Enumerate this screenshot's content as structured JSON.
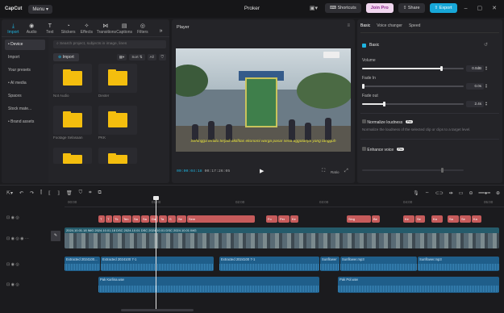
{
  "titlebar": {
    "logo": "CapCut",
    "menu": "Menu",
    "project_title": "Proker",
    "shortcuts": "Shortcuts",
    "join_pro": "Join Pro",
    "share": "Share",
    "export": "Export"
  },
  "left_tabs": [
    {
      "label": "Import",
      "icon": "import-icon"
    },
    {
      "label": "Audio",
      "icon": "audio-icon"
    },
    {
      "label": "Text",
      "icon": "text-icon"
    },
    {
      "label": "Stickers",
      "icon": "stickers-icon"
    },
    {
      "label": "Effects",
      "icon": "effects-icon"
    },
    {
      "label": "Transitions",
      "icon": "transitions-icon"
    },
    {
      "label": "Captions",
      "icon": "captions-icon"
    },
    {
      "label": "Filters",
      "icon": "filters-icon"
    }
  ],
  "sidenav": [
    "• Device",
    "Import",
    "Your presets",
    "• AI media",
    "Spaces",
    "Stock mate...",
    "• Brand assets"
  ],
  "media": {
    "search_placeholder": "Search project, subjects in image, lines",
    "import": "Import",
    "sort": "Sort",
    "filter_all": "All",
    "all_label": "All",
    "items": [
      "Not Audio",
      "Dexter",
      "Footage Selasaan",
      "PKK",
      "",
      ""
    ]
  },
  "player": {
    "title": "Player",
    "subtitle": "Sehingga terlalu terjadi aktifitas ekonomi warga pasar serta aggotanya yang tangguh",
    "current_time": "00:00:04:18",
    "total_time": "00:17:26:05",
    "ratio": "Ratio"
  },
  "props": {
    "tabs": [
      "Basic",
      "Voice changer",
      "Speed"
    ],
    "basic": "Basic",
    "volume": {
      "label": "Volume",
      "value": "0.0dB",
      "level": 0.78
    },
    "fade_in": {
      "label": "Fade In",
      "value": "0.0s",
      "level": 0.0
    },
    "fade_out": {
      "label": "Fade out",
      "value": "2.4s",
      "level": 0.22
    },
    "normalize": {
      "label": "Normalize loudness",
      "desc": "Normalize the loudness of the selected clip or clips to a target level."
    },
    "enhance": "Enhance voice",
    "pro": "Pro"
  },
  "timeline": {
    "ruler": [
      "00:00",
      "01:00",
      "02:00",
      "03:00",
      "04:00",
      "05:00"
    ],
    "text_clips": [
      "T",
      "T",
      "Tk",
      "Ten",
      "Sa",
      "Sa",
      "Da",
      "Ta",
      "S",
      "Se",
      "Sem",
      "Fo",
      "Per",
      "Ke",
      "Sing",
      "Be",
      "Ke",
      "Se",
      "Ka",
      "Sa",
      "Se",
      "Ka"
    ],
    "video_label": "2024.10.01.18 IMG 2024.10.01.18 DSC 2024.10.01 DSC 2024.10.01 DSC 2024.10.01 IMG",
    "cover": "Cover",
    "audio1": [
      "Extracted 2024100...",
      "Extracted 2024100 7-1",
      "Extracted 2024100 7-1",
      "Sunflower",
      "Sunflower.mp3",
      "Sunflower.mp3"
    ],
    "audio2": [
      "Pak Karlina.wav",
      "Pak Pol.wav"
    ]
  },
  "colors": {
    "accent": "#1eb4e0",
    "text_clip": "#c65b5b",
    "audio": "#1f5e8a",
    "video": "#255b6b",
    "folder": "#f4be0e"
  }
}
